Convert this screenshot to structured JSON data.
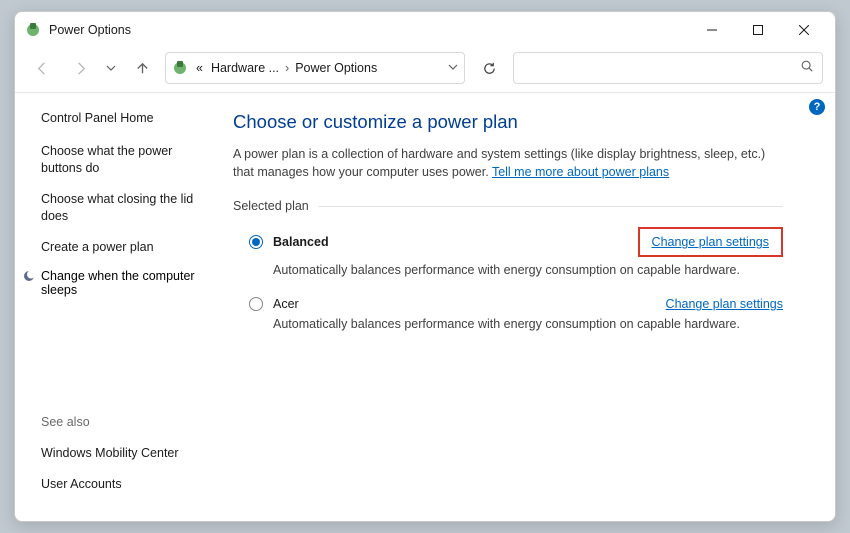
{
  "window": {
    "title": "Power Options"
  },
  "breadcrumb": {
    "seg1": "Hardware ...",
    "seg2": "Power Options"
  },
  "sidebar": {
    "home": "Control Panel Home",
    "links": [
      "Choose what the power buttons do",
      "Choose what closing the lid does",
      "Create a power plan",
      "Change when the computer sleeps"
    ],
    "see_also_h": "See also",
    "see_also": [
      "Windows Mobility Center",
      "User Accounts"
    ]
  },
  "main": {
    "heading": "Choose or customize a power plan",
    "desc_pre": "A power plan is a collection of hardware and system settings (like display brightness, sleep, etc.) that manages how your computer uses power. ",
    "desc_link": "Tell me more about power plans",
    "selected_label": "Selected plan",
    "plans": [
      {
        "name": "Balanced",
        "desc": "Automatically balances performance with energy consumption on capable hardware.",
        "link": "Change plan settings",
        "checked": true,
        "highlighted": true
      },
      {
        "name": "Acer",
        "desc": "Automatically balances performance with energy consumption on capable hardware.",
        "link": "Change plan settings",
        "checked": false,
        "highlighted": false
      }
    ]
  },
  "help": "?"
}
